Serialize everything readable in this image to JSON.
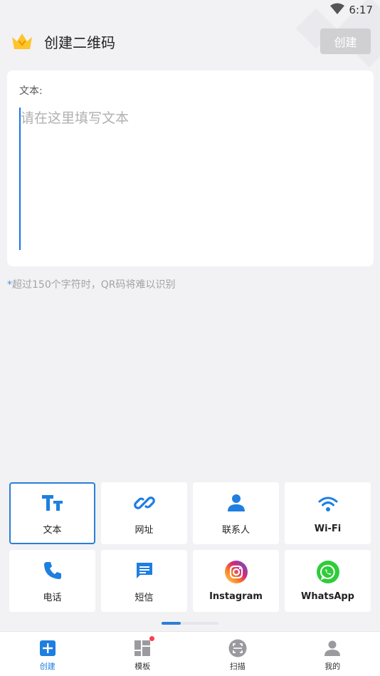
{
  "status_bar": {
    "time": "6:17"
  },
  "header": {
    "title": "创建二维码",
    "create_label": "创建"
  },
  "editor": {
    "label": "文本:",
    "placeholder": "请在这里填写文本",
    "value": ""
  },
  "hint": {
    "star": "*",
    "text": "超过150个字符时，QR码将难以识别"
  },
  "types": [
    {
      "label": "文本",
      "icon": "text-format-icon",
      "active": true
    },
    {
      "label": "网址",
      "icon": "link-icon"
    },
    {
      "label": "联系人",
      "icon": "person-icon"
    },
    {
      "label": "Wi-Fi",
      "icon": "wifi-icon"
    },
    {
      "label": "电话",
      "icon": "phone-icon"
    },
    {
      "label": "短信",
      "icon": "message-icon"
    },
    {
      "label": "Instagram",
      "icon": "instagram-icon"
    },
    {
      "label": "WhatsApp",
      "icon": "whatsapp-icon"
    }
  ],
  "bottom_nav": [
    {
      "label": "创建",
      "icon": "plus-square-icon",
      "active": true
    },
    {
      "label": "模板",
      "icon": "template-grid-icon",
      "badge": true
    },
    {
      "label": "扫描",
      "icon": "scan-icon"
    },
    {
      "label": "我的",
      "icon": "profile-icon"
    }
  ],
  "colors": {
    "accent": "#2a7fd6",
    "background": "#f2f2f5",
    "disabled_button": "#d0d0d3",
    "badge": "#ff3b4f"
  }
}
